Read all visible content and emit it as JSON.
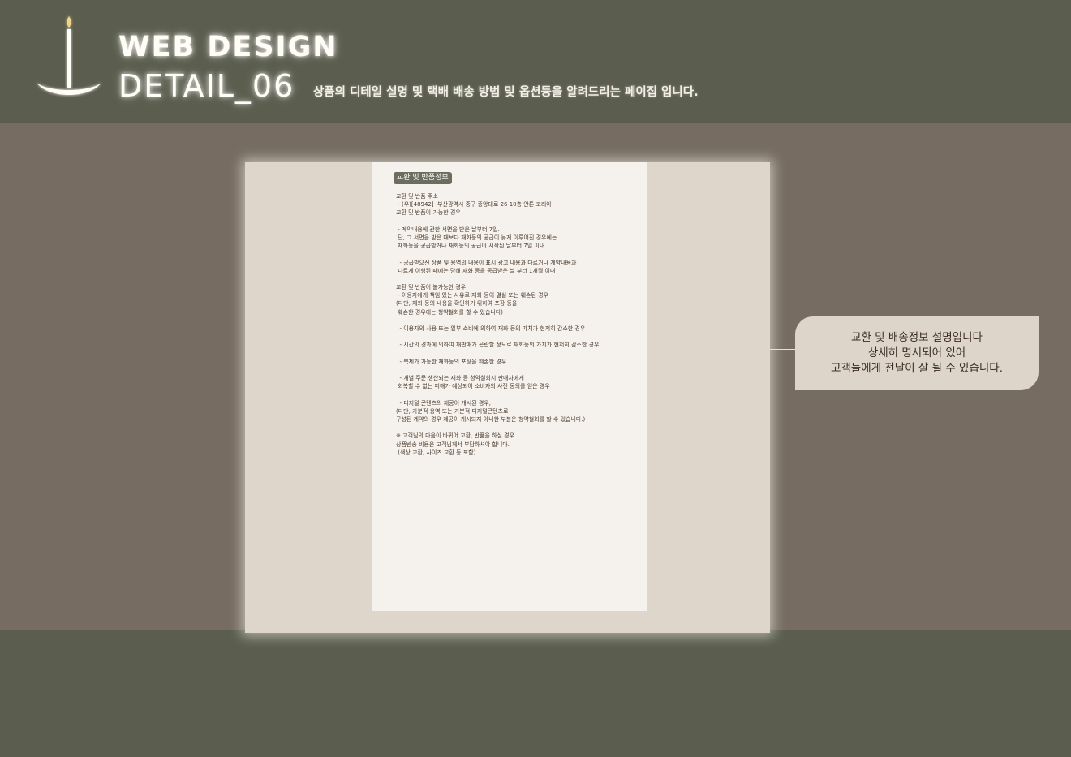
{
  "header": {
    "title_line1": "WEB DESIGN",
    "title_line2": "DETAIL_06",
    "subtitle": "상품의 디테일 설명 및 택배 배송 방법 및 옵션등을 알려드리는 페이집 입니다."
  },
  "detail_sheet": {
    "tag": "교환 및 반품정보",
    "lines": [
      "교환 및 반품 주소",
      " - (우)[48942]  부산광역시 중구 중앙대로 26 10층 안톤 코리아",
      "교환 및 반품이 가능한 경우",
      "",
      " - 계약내용에 관한 서면을 받은 날부터 7일.",
      " 단, 그 서면을 받은 때보다 재화등의 공급이 늦게 이루어진 경우에는",
      " 재화등을 공급받거나 재화등의 공급이 시작된 날부터 7일 이내",
      "",
      "  - 공급받으신 상품 및 용역의 내용이 표시.광고 내용과 다르거나 계약내용과",
      " 다르게 이행된 때에는 당해 재화 등을 공급받은 날 부터 1개월 이내",
      "",
      "교환 및 반품이 불가능한 경우",
      " - 이용자에게 책임 있는 사유로 재화 등이 멸실 또는 훼손된 경우",
      "(다만, 재화 등의 내용을 확인하기 위하여 포장 등을",
      " 훼손한 경우에는 청약철회를 할 수 있습니다)",
      "",
      "  - 이용자의 사용 또는 일부 소비에 의하여 재화 등의 가치가 현저히 감소한 경우",
      "",
      "  - 시간의 경과에 의하여 재판매가 곤란할 정도로 재화등의 가치가 현저히 감소한 경우",
      "",
      "  - 복제가 가능한 재화등의 포장을 훼손한 경우",
      "",
      "  - 개별 주문 생산되는 재화 등 청약철회시 판매자에게",
      " 회복할 수 없는 피해가 예상되어 소비자의 사전 동의를 얻은 경우",
      "",
      "  - 디지털 콘텐츠의 제공이 개시된 경우,",
      "(다만, 가분적 용역 또는 가분적 디지털콘텐츠로",
      "구성된 계약의 경우 제공이 개시되지 아니한 부분은 청약철회를 할 수 있습니다.)",
      "",
      "※ 고객님의 마음이 바뀌어 교환, 반품을 하실 경우",
      "상품반송 비용은 고객님께서 부담하셔야 합니다.",
      " (색상 교환, 사이즈 교환 등 포함)"
    ]
  },
  "callout": {
    "lines": [
      "교환 및 배송정보 설명입니다",
      "상세히 명시되어 있어",
      "고객들에게 전달이 잘 될 수 있습니다."
    ]
  },
  "colors": {
    "band": "#5b5e4e",
    "background": "#766c62",
    "panel": "#ded6cb",
    "sheet": "#f5f1ec",
    "tag": "#6b6e5e"
  },
  "icons": {
    "logo": "candle-icon"
  }
}
